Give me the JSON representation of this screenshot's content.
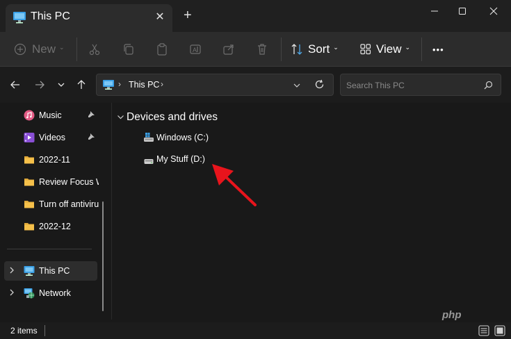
{
  "window": {
    "tab_title": "This PC",
    "new_tab_label": "+"
  },
  "commandbar": {
    "new_label": "New",
    "sort_label": "Sort",
    "view_label": "View",
    "more_label": "•••"
  },
  "address": {
    "segments": [
      "This PC"
    ]
  },
  "search": {
    "placeholder": "Search This PC"
  },
  "sidebar": {
    "items": [
      {
        "label": "Music",
        "icon": "music-icon",
        "pinned": true
      },
      {
        "label": "Videos",
        "icon": "videos-icon",
        "pinned": true
      },
      {
        "label": "2022-11",
        "icon": "folder-icon",
        "pinned": false
      },
      {
        "label": "Review Focus W",
        "icon": "folder-icon",
        "pinned": false
      },
      {
        "label": "Turn off antiviru",
        "icon": "folder-icon",
        "pinned": false
      },
      {
        "label": "2022-12",
        "icon": "folder-icon",
        "pinned": false
      }
    ],
    "tree": [
      {
        "label": "This PC",
        "icon": "pc-icon",
        "selected": true
      },
      {
        "label": "Network",
        "icon": "network-icon",
        "selected": false
      }
    ]
  },
  "content": {
    "group_title": "Devices and drives",
    "drives": [
      {
        "label": "Windows (C:)",
        "icon": "windows-drive-icon"
      },
      {
        "label": "My Stuff (D:)",
        "icon": "drive-icon"
      }
    ]
  },
  "status": {
    "item_count": "2 items"
  },
  "watermark": "php",
  "colors": {
    "accent_arrow": "#e8141c",
    "folder": "#f5c04a",
    "pc_blue": "#3aa0e6"
  }
}
